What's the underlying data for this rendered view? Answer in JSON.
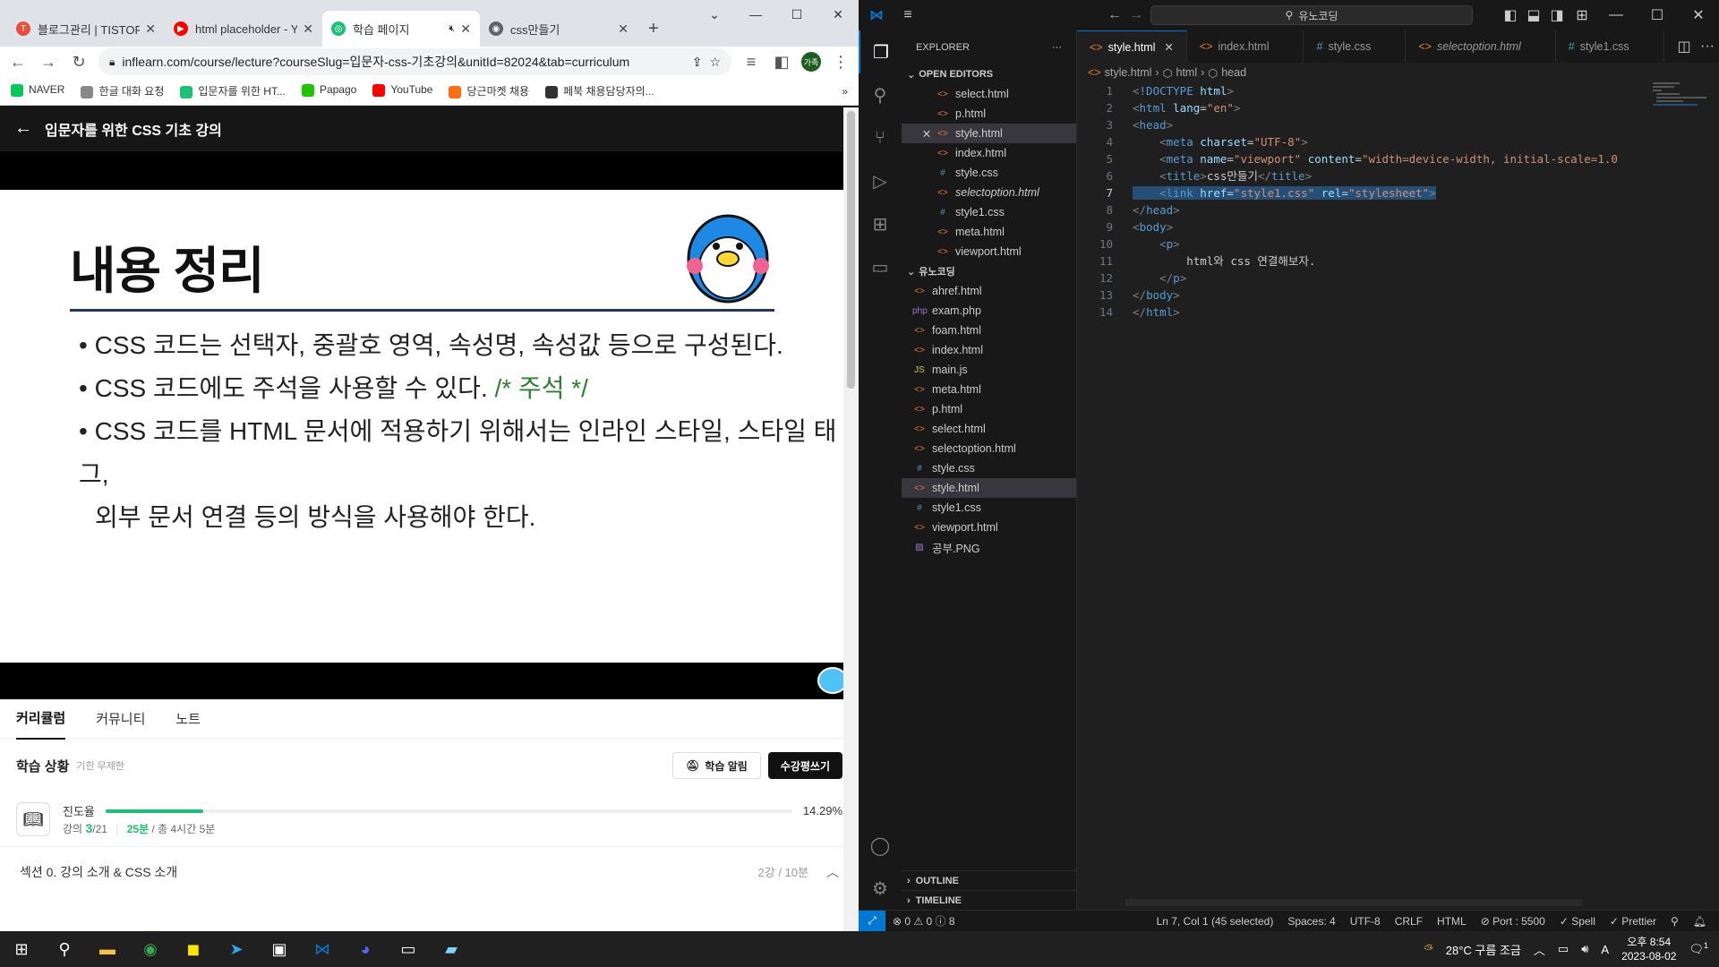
{
  "chrome": {
    "tabs": [
      {
        "title": "블로그관리 | TISTORY",
        "color": "#eb4d3d",
        "glyph": "T"
      },
      {
        "title": "html placeholder - YouTube",
        "color": "#ff0000",
        "glyph": "▶"
      },
      {
        "title": "학습 페이지",
        "color": "#1dc078",
        "glyph": "◎",
        "active": true
      },
      {
        "title": "css만들기",
        "color": "#5f6368",
        "glyph": "◉"
      }
    ],
    "url": "inflearn.com/course/lecture?courseSlug=입문자-css-기초강의&unitId=82024&tab=curriculum",
    "avatar": "가족",
    "bookmarks": [
      {
        "label": "NAVER",
        "color": "#03c75a"
      },
      {
        "label": "한글 대화 요청",
        "color": "#888"
      },
      {
        "label": "입문자를 위한 HT...",
        "color": "#1dc078"
      },
      {
        "label": "Papago",
        "color": "#1ec800"
      },
      {
        "label": "YouTube",
        "color": "#ff0000"
      },
      {
        "label": "당근마켓 채용",
        "color": "#ff6f0f"
      },
      {
        "label": "페북 채용담당자의...",
        "color": "#333"
      }
    ],
    "more_bookmarks": "»"
  },
  "lecture": {
    "title": "입문자를 위한 CSS 기초 강의",
    "slide": {
      "heading": "내용 정리",
      "bullets": [
        "CSS 코드는 선택자, 중괄호 영역, 속성명, 속성값 등으로 구성된다.",
        "CSS 코드에도 주석을 사용할 수 있다. ",
        "CSS 코드를 HTML 문서에 적용하기 위해서는 인라인 스타일, 스타일 태그,"
      ],
      "comment": "/* 주석 */",
      "continuation": "외부 문서 연결 등의 방식을 사용해야 한다."
    },
    "tabs": [
      "커리큘럼",
      "커뮤니티",
      "노트"
    ],
    "status_title": "학습 상황",
    "status_sub": "기한 무제한",
    "alert_button": "학습 알림",
    "review_button": "수강평쓰기",
    "progress_label": "진도율",
    "progress_percent": "14.29%",
    "progress_fraction": 0.1429,
    "lecture_label": "강의",
    "lecture_done": "3",
    "lecture_total": "/21",
    "time_done": "25분",
    "time_total": "/ 총 4시간 5분",
    "section_title": "섹션 0. 강의 소개 & CSS 소개",
    "section_meta": "2강 / 10분"
  },
  "vscode": {
    "search": "유노코딩",
    "explorer_label": "EXPLORER",
    "open_editors_label": "OPEN EDITORS",
    "open_editors": [
      {
        "name": "select.html",
        "t": "h"
      },
      {
        "name": "p.html",
        "t": "h"
      },
      {
        "name": "style.html",
        "t": "h",
        "sel": true
      },
      {
        "name": "index.html",
        "t": "h"
      },
      {
        "name": "style.css",
        "t": "c"
      },
      {
        "name": "selectoption.html",
        "t": "h",
        "italic": true
      },
      {
        "name": "style1.css",
        "t": "c"
      },
      {
        "name": "meta.html",
        "t": "h"
      },
      {
        "name": "viewport.html",
        "t": "h"
      }
    ],
    "folder_label": "유노코딩",
    "files": [
      {
        "name": "ahref.html",
        "t": "h"
      },
      {
        "name": "exam.php",
        "t": "p"
      },
      {
        "name": "foam.html",
        "t": "h"
      },
      {
        "name": "index.html",
        "t": "h"
      },
      {
        "name": "main.js",
        "t": "j"
      },
      {
        "name": "meta.html",
        "t": "h"
      },
      {
        "name": "p.html",
        "t": "h"
      },
      {
        "name": "select.html",
        "t": "h"
      },
      {
        "name": "selectoption.html",
        "t": "h"
      },
      {
        "name": "style.css",
        "t": "c"
      },
      {
        "name": "style.html",
        "t": "h",
        "sel": true
      },
      {
        "name": "style1.css",
        "t": "c"
      },
      {
        "name": "viewport.html",
        "t": "h"
      },
      {
        "name": "공부.PNG",
        "t": "i"
      }
    ],
    "outline_label": "OUTLINE",
    "timeline_label": "TIMELINE",
    "tabs": [
      {
        "name": "style.html",
        "t": "h",
        "on": true
      },
      {
        "name": "index.html",
        "t": "h"
      },
      {
        "name": "style.css",
        "t": "c"
      },
      {
        "name": "selectoption.html",
        "t": "h",
        "italic": true
      },
      {
        "name": "style1.css",
        "t": "c"
      }
    ],
    "breadcrumb": [
      "style.html",
      "html",
      "head"
    ],
    "status": {
      "errors": "⊗ 0 ⚠ 0 ⓘ 8",
      "position": "Ln 7, Col 1 (45 selected)",
      "spaces": "Spaces: 4",
      "encoding": "UTF-8",
      "eol": "CRLF",
      "lang": "HTML",
      "port": "⊘ Port : 5500",
      "spell": "✓ Spell",
      "prettier": "✓ Prettier"
    }
  },
  "taskbar": {
    "weather": "28°C 구름 조금",
    "time": "오후 8:54",
    "date": "2023-08-02",
    "notif": "1",
    "ime": "A"
  }
}
